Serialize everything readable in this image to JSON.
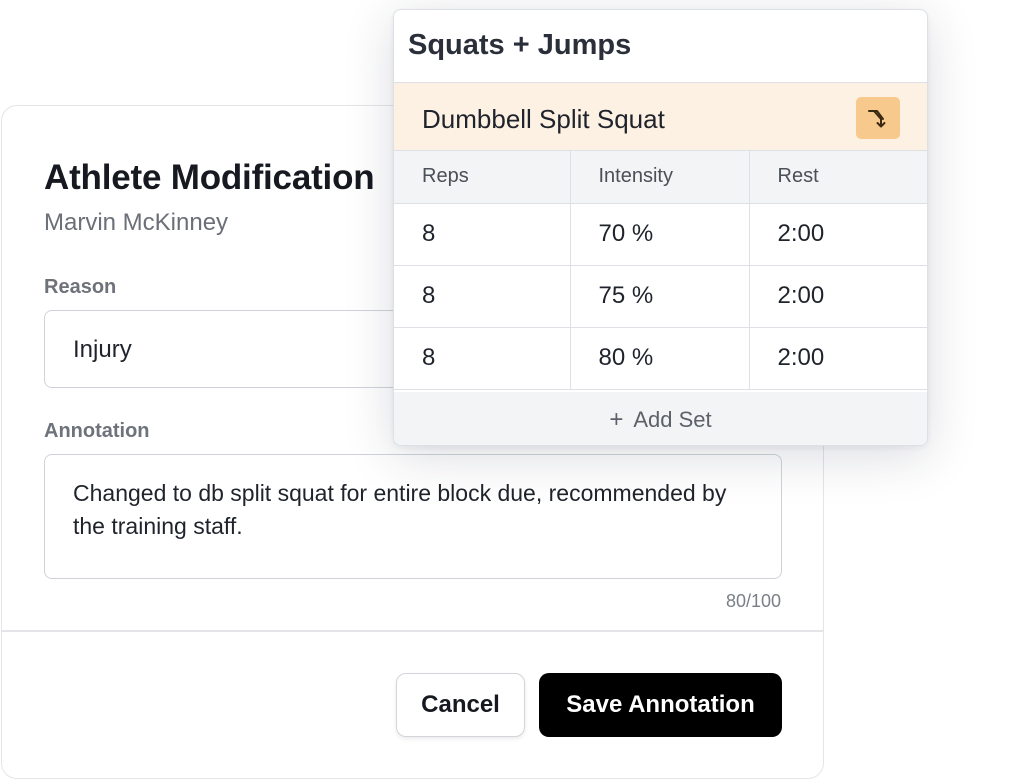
{
  "modification": {
    "title": "Athlete Modification",
    "athlete_name": "Marvin McKinney",
    "reason_label": "Reason",
    "reason_value": "Injury",
    "annotation_label": "Annotation",
    "annotation_text": "Changed to db split squat for entire block due, recommended by the training staff.",
    "char_count": "80/100",
    "cancel_label": "Cancel",
    "save_label": "Save Annotation"
  },
  "exercise_card": {
    "title": "Squats + Jumps",
    "exercise_name": "Dumbbell Split Squat",
    "swap_icon": "swap-arrow-icon",
    "columns": [
      "Reps",
      "Intensity",
      "Rest"
    ],
    "sets": [
      {
        "reps": "8",
        "intensity": "70 %",
        "rest": "2:00"
      },
      {
        "reps": "8",
        "intensity": "75 %",
        "rest": "2:00"
      },
      {
        "reps": "8",
        "intensity": "80 %",
        "rest": "2:00"
      }
    ],
    "add_set_icon": "plus-icon",
    "add_set_label": "Add Set"
  },
  "colors": {
    "exercise_highlight": "#fdf1e3",
    "swap_button": "#f8c98c",
    "primary_button": "#000000"
  }
}
